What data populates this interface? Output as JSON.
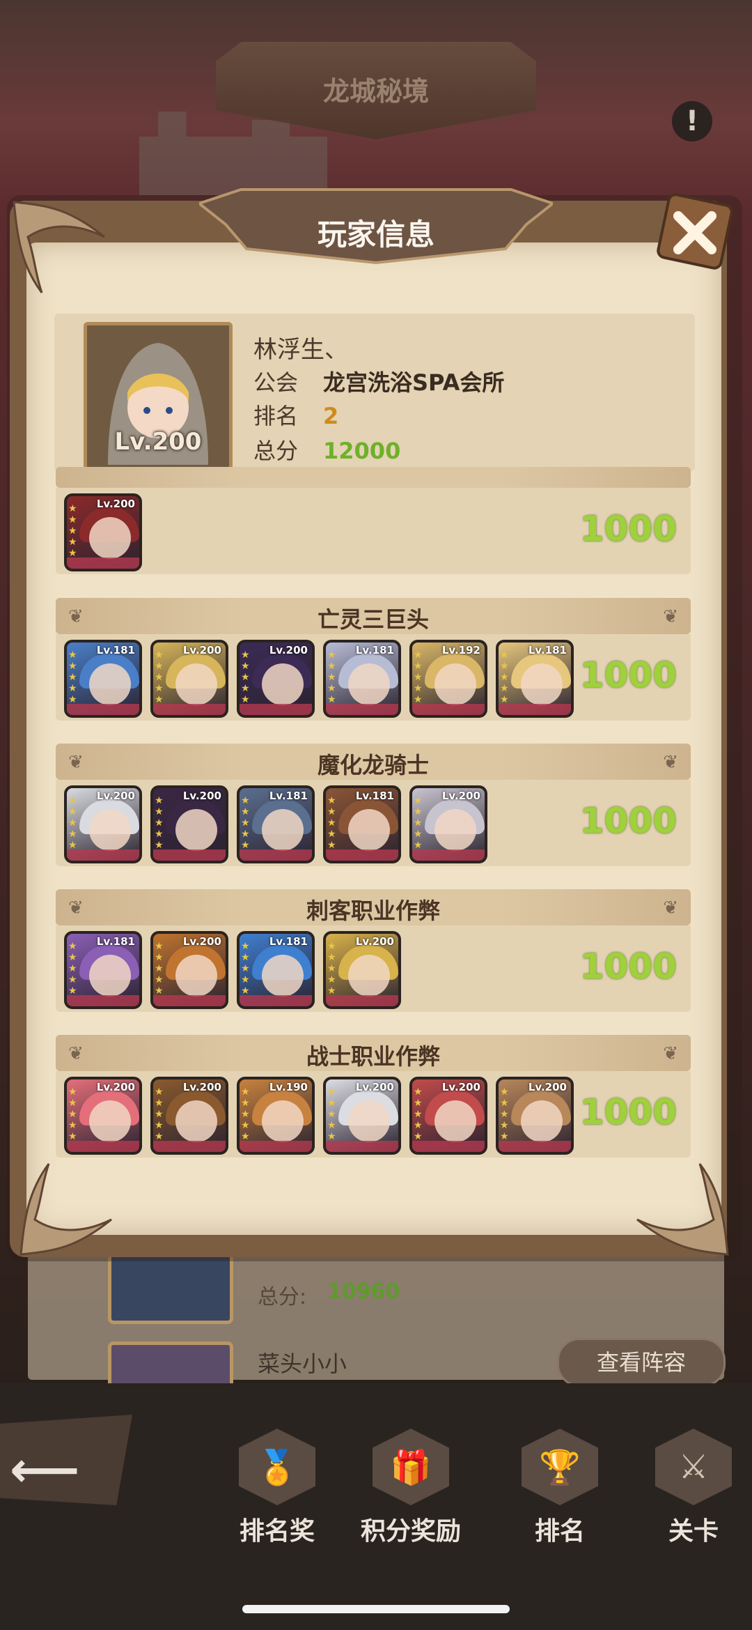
{
  "background": {
    "screen_title": "龙城秘境",
    "alert_icon": "!",
    "list_row": {
      "total_label": "总分:",
      "total_value": "10960",
      "next_name": "菜头小小",
      "view_button": "查看阵容"
    }
  },
  "modal": {
    "title": "玩家信息",
    "close_icon": "close-icon",
    "player": {
      "name": "林浮生、",
      "level": "Lv.200",
      "guild_label": "公会",
      "guild_value": "龙宫洗浴SPA会所",
      "rank_label": "排名",
      "rank_value": "2",
      "score_label": "总分",
      "score_value": "12000"
    },
    "teams": [
      {
        "title": "",
        "score": "1000",
        "heroes": [
          {
            "level": "Lv.200",
            "color": "#8b2a2a"
          }
        ]
      },
      {
        "title": "亡灵三巨头",
        "score": "1000",
        "heroes": [
          {
            "level": "Lv.181",
            "color": "#4a7fc8"
          },
          {
            "level": "Lv.200",
            "color": "#d7b55a"
          },
          {
            "level": "Lv.200",
            "color": "#3b2b55"
          },
          {
            "level": "Lv.181",
            "color": "#b7bcd5"
          },
          {
            "level": "Lv.192",
            "color": "#d9b767"
          },
          {
            "level": "Lv.181",
            "color": "#e6c77d"
          }
        ]
      },
      {
        "title": "魔化龙骑士",
        "score": "1000",
        "heroes": [
          {
            "level": "Lv.200",
            "color": "#d9dbe0"
          },
          {
            "level": "Lv.200",
            "color": "#3a2744"
          },
          {
            "level": "Lv.181",
            "color": "#5b6f8f"
          },
          {
            "level": "Lv.181",
            "color": "#8a5536"
          },
          {
            "level": "Lv.200",
            "color": "#c8c4cf"
          }
        ]
      },
      {
        "title": "刺客职业作弊",
        "score": "1000",
        "heroes": [
          {
            "level": "Lv.181",
            "color": "#8b5fb5"
          },
          {
            "level": "Lv.200",
            "color": "#c0742f"
          },
          {
            "level": "Lv.181",
            "color": "#3f7fd0"
          },
          {
            "level": "Lv.200",
            "color": "#d8b24a"
          }
        ]
      },
      {
        "title": "战士职业作弊",
        "score": "1000",
        "heroes": [
          {
            "level": "Lv.200",
            "color": "#e46f7a"
          },
          {
            "level": "Lv.200",
            "color": "#8a5a2e"
          },
          {
            "level": "Lv.190",
            "color": "#c8823f"
          },
          {
            "level": "Lv.200",
            "color": "#dcdde3"
          },
          {
            "level": "Lv.200",
            "color": "#c24b4b"
          },
          {
            "level": "Lv.200",
            "color": "#b8875a"
          }
        ]
      }
    ]
  },
  "nav": {
    "back_icon": "back-arrow-icon",
    "items": [
      {
        "label": "排名奖",
        "icon": "rank-reward-icon"
      },
      {
        "label": "积分奖励",
        "icon": "points-reward-icon"
      },
      {
        "label": "排名",
        "icon": "ranking-icon"
      },
      {
        "label": "关卡",
        "icon": "stage-icon"
      }
    ]
  },
  "colors": {
    "score_green": "#9ed13a",
    "rank_orange": "#d08a1c",
    "total_green": "#6fb02a"
  }
}
